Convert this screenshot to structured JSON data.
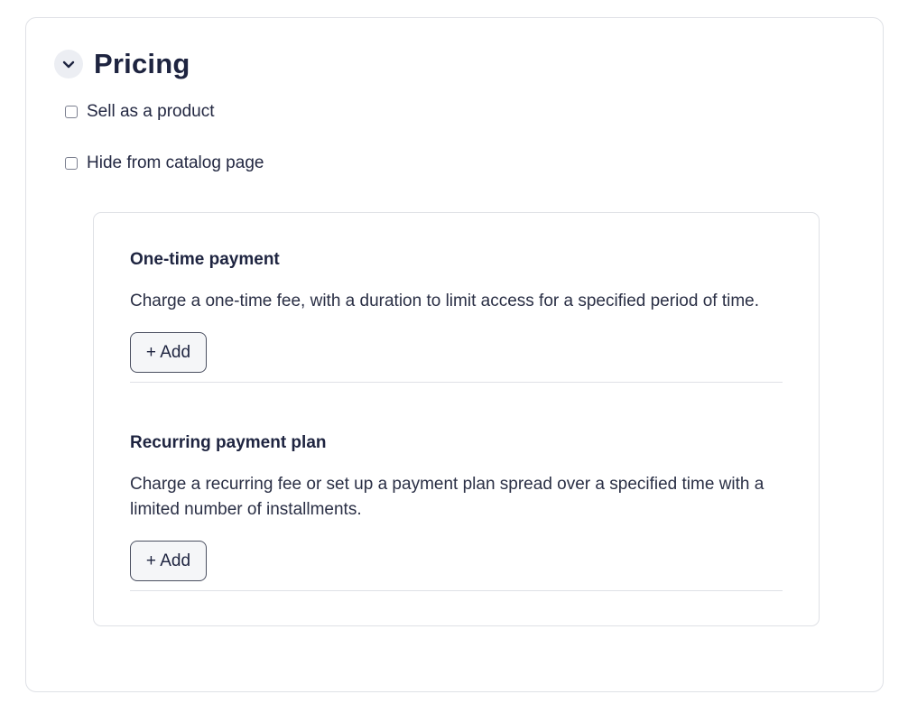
{
  "pricing": {
    "title": "Pricing",
    "options": [
      {
        "label": "Sell as a product",
        "checked": false
      },
      {
        "label": "Hide from catalog page",
        "checked": false
      }
    ],
    "sections": [
      {
        "title": "One-time payment",
        "description": "Charge a one-time fee, with a duration to limit access for a specified period of time.",
        "button_label": "+ Add"
      },
      {
        "title": "Recurring payment plan",
        "description": "Charge a recurring fee or set up a payment plan spread over a specified time with a limited number of installments.",
        "button_label": "+ Add"
      }
    ]
  },
  "icons": {
    "collapse": "chevron-down-icon"
  },
  "colors": {
    "text": "#1e2440",
    "border": "#dfe1e6",
    "toggle_bg": "#eceef3"
  }
}
